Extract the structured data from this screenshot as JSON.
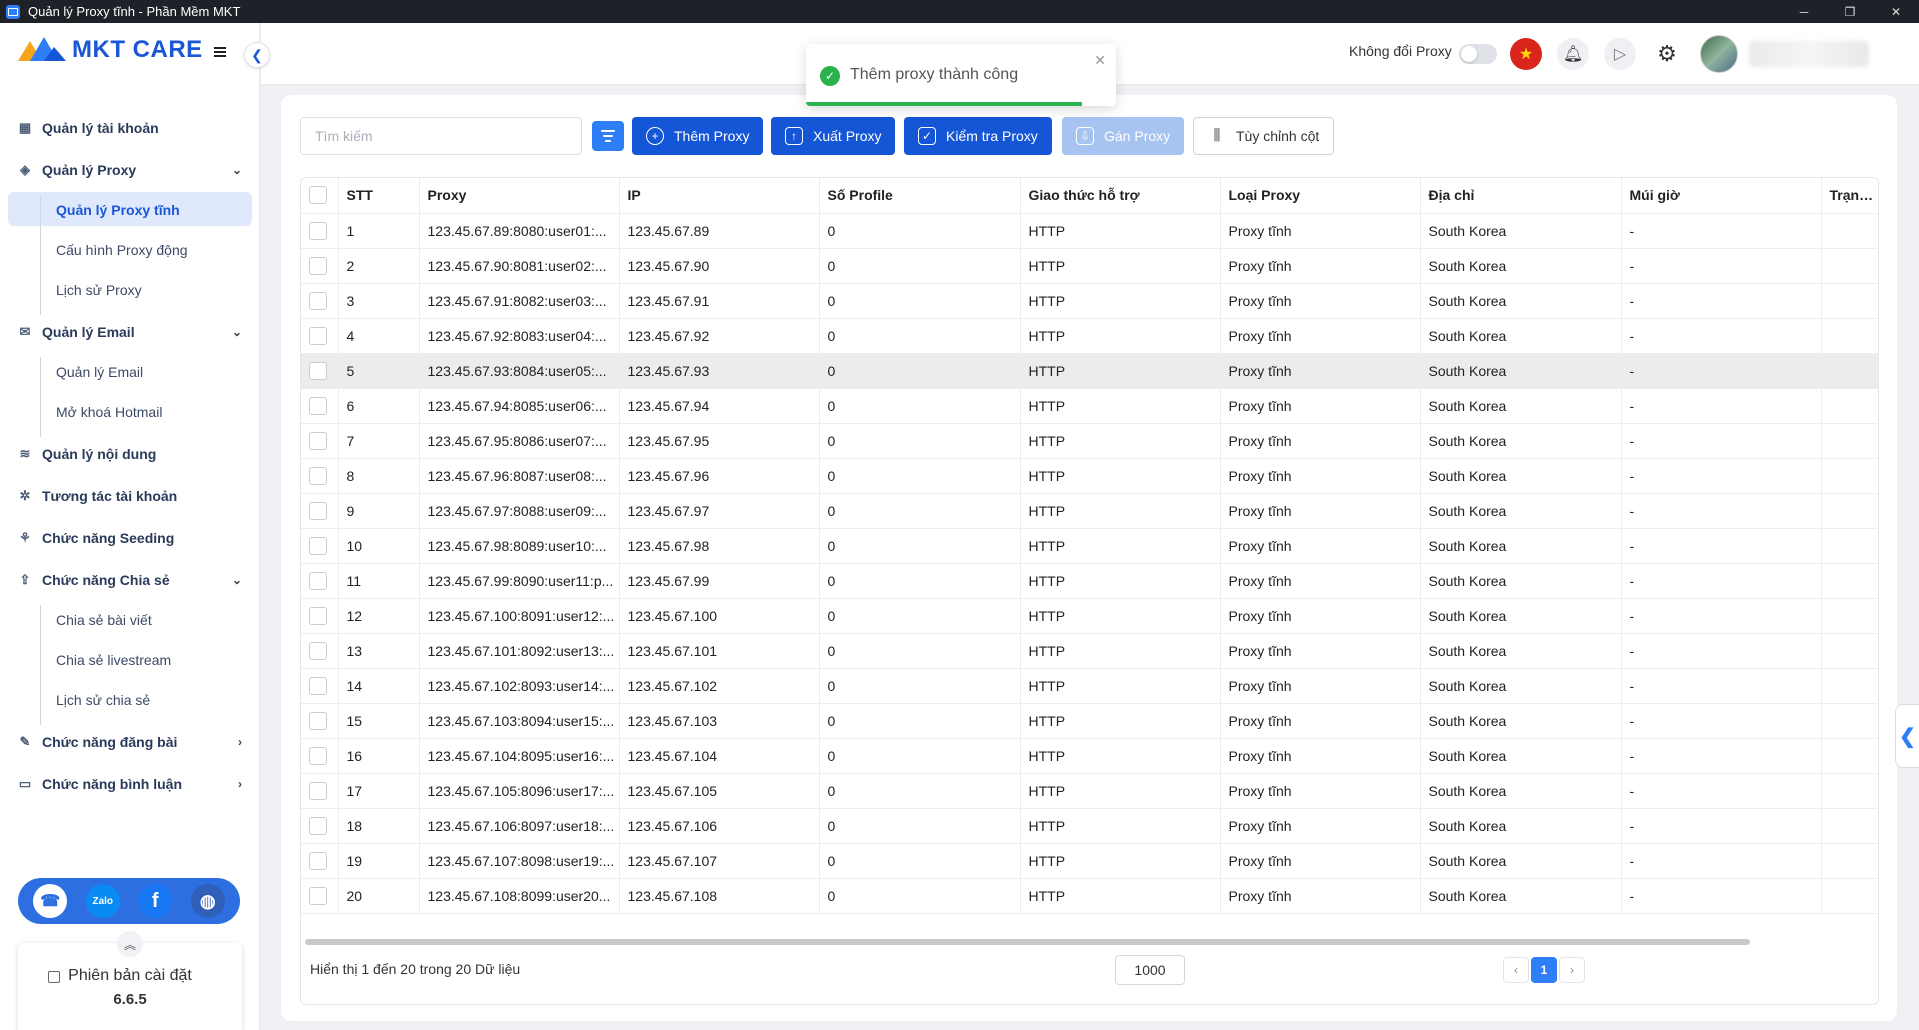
{
  "window": {
    "title": "Quản lý Proxy tĩnh - Phần Mềm MKT",
    "minimize": "─",
    "maximize": "❐",
    "close": "✕"
  },
  "brand": {
    "logo_text": "MKT CARE",
    "accent": "#1456d6"
  },
  "sidebar": {
    "items": [
      {
        "label": "Quản lý tài khoản",
        "icon": "dashboard-icon"
      },
      {
        "label": "Quản lý Proxy",
        "icon": "layers-icon",
        "expanded": true,
        "children": [
          "Quản lý Proxy tĩnh",
          "Cấu hình Proxy động",
          "Lịch sử Proxy"
        ]
      },
      {
        "label": "Quản lý Email",
        "icon": "mail-icon",
        "expanded": true,
        "children": [
          "Quản lý Email",
          "Mở khoá Hotmail"
        ]
      },
      {
        "label": "Quản lý nội dung",
        "icon": "content-icon"
      },
      {
        "label": "Tương tác tài khoản",
        "icon": "interact-icon"
      },
      {
        "label": "Chức năng Seeding",
        "icon": "seeding-icon"
      },
      {
        "label": "Chức năng Chia sẻ",
        "icon": "share-icon",
        "expanded": true,
        "children": [
          "Chia sẻ bài viết",
          "Chia sẻ livestream",
          "Lịch sử chia sẻ"
        ]
      },
      {
        "label": "Chức năng đăng bài",
        "icon": "post-icon"
      },
      {
        "label": "Chức năng bình luận",
        "icon": "comment-icon"
      }
    ],
    "active_child": "Quản lý Proxy tĩnh",
    "social": [
      "support-icon",
      "zalo-icon",
      "facebook-icon",
      "globe-icon"
    ],
    "version_label": "Phiên bản cài đặt",
    "version": "6.6.5"
  },
  "header": {
    "proxy_toggle_label": "Không đổi Proxy",
    "proxy_toggle_on": false
  },
  "toast": {
    "message": "Thêm proxy thành công",
    "type": "success",
    "color": "#2bb24c"
  },
  "toolbar": {
    "search_placeholder": "Tìm kiếm",
    "add_label": "Thêm Proxy",
    "export_label": "Xuất Proxy",
    "check_label": "Kiểm tra Proxy",
    "assign_label": "Gán Proxy",
    "columns_label": "Tùy chỉnh cột"
  },
  "table": {
    "columns": [
      "STT",
      "Proxy",
      "IP",
      "Số Profile",
      "Giao thức hỗ trợ",
      "Loại Proxy",
      "Địa chỉ",
      "Múi giờ",
      "Trạng th"
    ],
    "rows": [
      [
        "1",
        "123.45.67.89:8080:user01:...",
        "123.45.67.89",
        "0",
        "HTTP",
        "Proxy tĩnh",
        "South Korea",
        "-",
        ""
      ],
      [
        "2",
        "123.45.67.90:8081:user02:...",
        "123.45.67.90",
        "0",
        "HTTP",
        "Proxy tĩnh",
        "South Korea",
        "-",
        ""
      ],
      [
        "3",
        "123.45.67.91:8082:user03:...",
        "123.45.67.91",
        "0",
        "HTTP",
        "Proxy tĩnh",
        "South Korea",
        "-",
        ""
      ],
      [
        "4",
        "123.45.67.92:8083:user04:...",
        "123.45.67.92",
        "0",
        "HTTP",
        "Proxy tĩnh",
        "South Korea",
        "-",
        ""
      ],
      [
        "5",
        "123.45.67.93:8084:user05:...",
        "123.45.67.93",
        "0",
        "HTTP",
        "Proxy tĩnh",
        "South Korea",
        "-",
        ""
      ],
      [
        "6",
        "123.45.67.94:8085:user06:...",
        "123.45.67.94",
        "0",
        "HTTP",
        "Proxy tĩnh",
        "South Korea",
        "-",
        ""
      ],
      [
        "7",
        "123.45.67.95:8086:user07:...",
        "123.45.67.95",
        "0",
        "HTTP",
        "Proxy tĩnh",
        "South Korea",
        "-",
        ""
      ],
      [
        "8",
        "123.45.67.96:8087:user08:...",
        "123.45.67.96",
        "0",
        "HTTP",
        "Proxy tĩnh",
        "South Korea",
        "-",
        ""
      ],
      [
        "9",
        "123.45.67.97:8088:user09:...",
        "123.45.67.97",
        "0",
        "HTTP",
        "Proxy tĩnh",
        "South Korea",
        "-",
        ""
      ],
      [
        "10",
        "123.45.67.98:8089:user10:...",
        "123.45.67.98",
        "0",
        "HTTP",
        "Proxy tĩnh",
        "South Korea",
        "-",
        ""
      ],
      [
        "11",
        "123.45.67.99:8090:user11:p...",
        "123.45.67.99",
        "0",
        "HTTP",
        "Proxy tĩnh",
        "South Korea",
        "-",
        ""
      ],
      [
        "12",
        "123.45.67.100:8091:user12:...",
        "123.45.67.100",
        "0",
        "HTTP",
        "Proxy tĩnh",
        "South Korea",
        "-",
        ""
      ],
      [
        "13",
        "123.45.67.101:8092:user13:...",
        "123.45.67.101",
        "0",
        "HTTP",
        "Proxy tĩnh",
        "South Korea",
        "-",
        ""
      ],
      [
        "14",
        "123.45.67.102:8093:user14:...",
        "123.45.67.102",
        "0",
        "HTTP",
        "Proxy tĩnh",
        "South Korea",
        "-",
        ""
      ],
      [
        "15",
        "123.45.67.103:8094:user15:...",
        "123.45.67.103",
        "0",
        "HTTP",
        "Proxy tĩnh",
        "South Korea",
        "-",
        ""
      ],
      [
        "16",
        "123.45.67.104:8095:user16:...",
        "123.45.67.104",
        "0",
        "HTTP",
        "Proxy tĩnh",
        "South Korea",
        "-",
        ""
      ],
      [
        "17",
        "123.45.67.105:8096:user17:...",
        "123.45.67.105",
        "0",
        "HTTP",
        "Proxy tĩnh",
        "South Korea",
        "-",
        ""
      ],
      [
        "18",
        "123.45.67.106:8097:user18:...",
        "123.45.67.106",
        "0",
        "HTTP",
        "Proxy tĩnh",
        "South Korea",
        "-",
        ""
      ],
      [
        "19",
        "123.45.67.107:8098:user19:...",
        "123.45.67.107",
        "0",
        "HTTP",
        "Proxy tĩnh",
        "South Korea",
        "-",
        ""
      ],
      [
        "20",
        "123.45.67.108:8099:user20...",
        "123.45.67.108",
        "0",
        "HTTP",
        "Proxy tĩnh",
        "South Korea",
        "-",
        ""
      ]
    ],
    "highlighted_row": "5"
  },
  "footer": {
    "summary": "Hiển thị 1 đến 20 trong 20 Dữ liệu",
    "page_size": "1000",
    "prev": "‹",
    "current_page": "1",
    "next": "›"
  }
}
